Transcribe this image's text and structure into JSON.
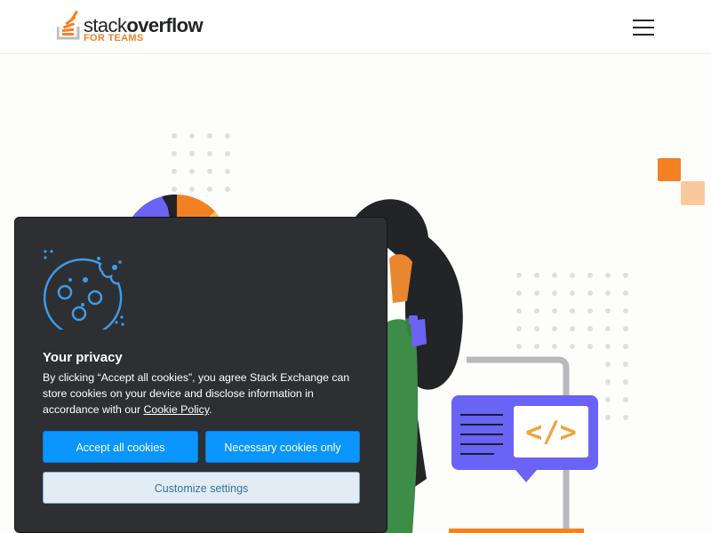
{
  "header": {
    "logo": {
      "main_regular": "stack",
      "main_bold": "overflow",
      "sub": "FOR TEAMS"
    },
    "menu_icon": "hamburger-menu-icon"
  },
  "illustration": {
    "elements": [
      "donut-chart",
      "person-illustration",
      "monitor",
      "code-chat-bubble",
      "orange-squares",
      "dot-grid"
    ],
    "code_glyph": "</>"
  },
  "cookie_dialog": {
    "icon": "cookie-icon",
    "title": "Your privacy",
    "body_before_link": "By clicking “Accept all cookies”, you agree Stack Exchange can store cookies on your device and disclose information in accordance with our ",
    "link_text": "Cookie Policy",
    "body_after_link": ".",
    "buttons": {
      "accept_all": "Accept all cookies",
      "necessary_only": "Necessary cookies only",
      "customize": "Customize settings"
    }
  },
  "colors": {
    "brand_orange": "#f48024",
    "primary_blue": "#0a95ff",
    "dialog_bg": "#2d2f33",
    "secondary_bg": "#e1ecf4",
    "illustration_purple": "#6a63f6",
    "illustration_green": "#3d8c47"
  }
}
